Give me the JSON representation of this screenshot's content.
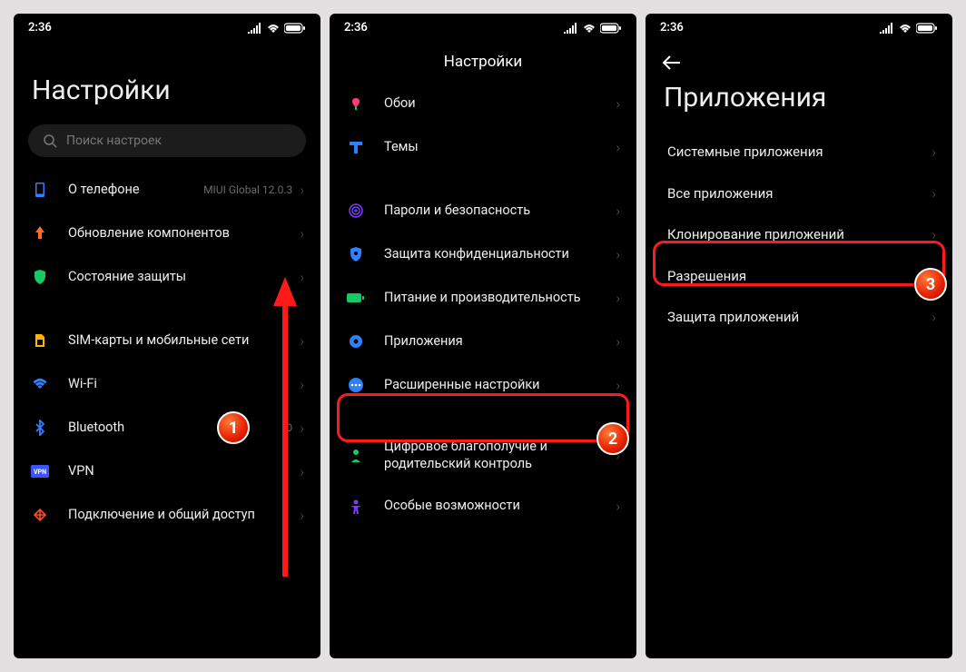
{
  "status": {
    "time": "2:36"
  },
  "phone1": {
    "title": "Настройки",
    "search_placeholder": "Поиск настроек",
    "badge": "1",
    "rows": {
      "about": {
        "label": "О телефоне",
        "sub": "MIUI Global 12.0.3"
      },
      "updates": {
        "label": "Обновление компонентов"
      },
      "security": {
        "label": "Состояние защиты"
      },
      "sim": {
        "label": "SIM-карты и мобильные сети"
      },
      "wifi": {
        "label": "Wi-Fi"
      },
      "bluetooth": {
        "label": "Bluetooth",
        "sub": "O"
      },
      "vpn": {
        "label": "VPN"
      },
      "sharing": {
        "label": "Подключение и общий доступ"
      }
    }
  },
  "phone2": {
    "title": "Настройки",
    "badge": "2",
    "rows": {
      "wallpaper": {
        "label": "Обои"
      },
      "themes": {
        "label": "Темы"
      },
      "passwords": {
        "label": "Пароли и безопасность"
      },
      "privacy": {
        "label": "Защита конфиденциальности"
      },
      "battery": {
        "label": "Питание и производительность"
      },
      "apps": {
        "label": "Приложения"
      },
      "advanced": {
        "label": "Расширенные настройки"
      },
      "wellbeing": {
        "label": "Цифровое благополучие и родительский контроль"
      },
      "accessibility": {
        "label": "Особые возможности"
      }
    }
  },
  "phone3": {
    "title": "Приложения",
    "badge": "3",
    "rows": {
      "system_apps": {
        "label": "Системные приложения"
      },
      "all_apps": {
        "label": "Все приложения"
      },
      "clone": {
        "label": "Клонирование приложений"
      },
      "permissions": {
        "label": "Разрешения"
      },
      "app_lock": {
        "label": "Защита приложений"
      }
    }
  }
}
